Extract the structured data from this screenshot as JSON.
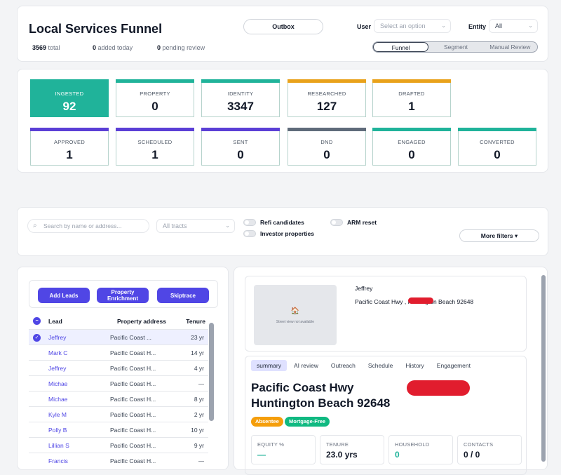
{
  "header": {
    "title": "Local Services Funnel",
    "stats": {
      "total": "3569",
      "total_label": "total",
      "added": "0",
      "added_label": "added today",
      "pending": "0",
      "pending_label": "pending review"
    },
    "outbox": "Outbox",
    "user_label": "User",
    "user_placeholder": "Select an option",
    "entity_label": "Entity",
    "entity_value": "All",
    "views": [
      "Funnel",
      "Segment",
      "Manual Review"
    ],
    "active_view": "Funnel"
  },
  "funnel": [
    {
      "label": "INGESTED",
      "value": "92",
      "color": "#20b39a"
    },
    {
      "label": "PROPERTY",
      "value": "0",
      "color": "#20b39a"
    },
    {
      "label": "IDENTITY",
      "value": "3347",
      "color": "#20b39a"
    },
    {
      "label": "RESEARCHED",
      "value": "127",
      "color": "#e9a21b"
    },
    {
      "label": "DRAFTED",
      "value": "1",
      "color": "#e9a21b"
    },
    {
      "label": "APPROVED",
      "value": "1",
      "color": "#5b3fd6"
    },
    {
      "label": "SCHEDULED",
      "value": "1",
      "color": "#5b3fd6"
    },
    {
      "label": "SENT",
      "value": "0",
      "color": "#5b3fd6"
    },
    {
      "label": "DND",
      "value": "0",
      "color": "#5f6b7a"
    },
    {
      "label": "ENGAGED",
      "value": "0",
      "color": "#20b39a"
    },
    {
      "label": "CONVERTED",
      "value": "0",
      "color": "#20b39a"
    }
  ],
  "filters": {
    "search_placeholder": "Search by name or address...",
    "tracts": "All tracts",
    "toggles": [
      "Refi candidates",
      "Investor properties",
      "ARM reset"
    ],
    "more": "More filters"
  },
  "actions": {
    "add": "Add Leads",
    "enrich": "Property Enrichment",
    "skiptrace": "Skiptrace"
  },
  "table": {
    "headers": {
      "lead": "Lead",
      "address": "Property address",
      "tenure": "Tenure"
    },
    "rows": [
      {
        "name": "Jeffrey",
        "address": "Pacific Coast ...",
        "tenure": "23 yr"
      },
      {
        "name": "Mark C",
        "address": "Pacific Coast H...",
        "tenure": "14 yr"
      },
      {
        "name": "Jeffrey",
        "address": "Pacific Coast H...",
        "tenure": "4 yr"
      },
      {
        "name": "Michae",
        "address": "Pacific Coast H...",
        "tenure": "—"
      },
      {
        "name": "Michae",
        "address": "Pacific Coast H...",
        "tenure": "8 yr"
      },
      {
        "name": "Kyle M",
        "address": "Pacific Coast H...",
        "tenure": "2 yr"
      },
      {
        "name": "Polly B",
        "address": "Pacific Coast H...",
        "tenure": "10 yr"
      },
      {
        "name": "Lillian S",
        "address": "Pacific Coast H...",
        "tenure": "9 yr"
      },
      {
        "name": "Francis",
        "address": "Pacific Coast H...",
        "tenure": "—"
      }
    ]
  },
  "detail": {
    "owner": "Jeffrey",
    "streetview": "Street view not available",
    "address_line": "Pacific Coast Hwy , Huntington Beach 92648",
    "tabs": [
      "summary",
      "AI review",
      "Outreach",
      "Schedule",
      "History",
      "Engagement"
    ],
    "active_tab": "summary",
    "big_line1": "Pacific Coast Hwy",
    "big_line2": "Huntington Beach 92648",
    "badges": [
      {
        "text": "Absentee",
        "color": "#f59e0b"
      },
      {
        "text": "Mortgage-Free",
        "color": "#10b981"
      }
    ],
    "metrics": [
      {
        "label": "EQUITY %",
        "value": "—"
      },
      {
        "label": "TENURE",
        "value": "23.0 yrs"
      },
      {
        "label": "HOUSEHOLD",
        "value": "0"
      },
      {
        "label": "CONTACTS",
        "value": "0 / 0"
      }
    ]
  }
}
